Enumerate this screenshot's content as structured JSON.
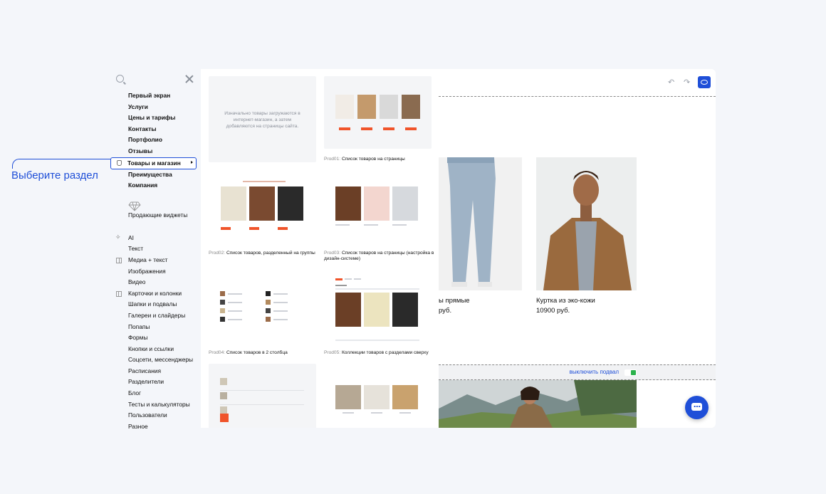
{
  "callout": {
    "label": "Выберите раздел"
  },
  "menu": {
    "sections": [
      {
        "label": "Первый экран",
        "bold": true
      },
      {
        "label": "Услуги",
        "bold": true
      },
      {
        "label": "Цены и тарифы",
        "bold": true
      },
      {
        "label": "Контакты",
        "bold": true
      },
      {
        "label": "Портфолио",
        "bold": true
      },
      {
        "label": "Отзывы",
        "bold": true
      },
      {
        "label": "Товары и магазин",
        "bold": true,
        "active": true
      },
      {
        "label": "Преимущества",
        "bold": true
      },
      {
        "label": "Компания",
        "bold": true
      }
    ],
    "promo": {
      "label": "Продающие виджеты",
      "icon": "diamond-icon"
    },
    "blocks": [
      {
        "label": "AI",
        "icon": "ai-icon"
      },
      {
        "label": "Текст"
      },
      {
        "label": "Медиа + текст",
        "icon": "media-icon"
      },
      {
        "label": "Изображения"
      },
      {
        "label": "Видео"
      },
      {
        "label": "Карточки и колонки",
        "icon": "cards-icon"
      },
      {
        "label": "Шапки и подвалы"
      },
      {
        "label": "Галереи и слайдеры"
      },
      {
        "label": "Попапы"
      },
      {
        "label": "Формы"
      },
      {
        "label": "Кнопки и ссылки"
      },
      {
        "label": "Соцсети, мессенджеры"
      },
      {
        "label": "Расписания"
      },
      {
        "label": "Разделители"
      },
      {
        "label": "Блог"
      },
      {
        "label": "Тесты и калькуляторы"
      },
      {
        "label": "Пользователи"
      },
      {
        "label": "Разное"
      }
    ]
  },
  "templates": {
    "intro": "Изначально товары загружаются в интернет-магазин, а затем добавляются на страницы сайта.",
    "cards": [
      {
        "code": "Prod01:",
        "name": "Список товаров на страницы"
      },
      {
        "code": "Prod02:",
        "name": "Список товаров, разделенный на группы"
      },
      {
        "code": "Prod03:",
        "name": "Список товаров на страницы (настройка в дизайн-системе)"
      },
      {
        "code": "Prod04:",
        "name": "Список товаров в 2 столбца"
      },
      {
        "code": "Prod05:",
        "name": "Коллекции товаров с разделами сверху"
      }
    ]
  },
  "preview": {
    "products": [
      {
        "title": "ы прямые",
        "price": "руб."
      },
      {
        "title": "Куртка из эко-кожи",
        "price": "10900 руб."
      }
    ],
    "footer_toggle": "выключить подвал"
  },
  "colors": {
    "accent": "#1f4fd8",
    "sale": "#f0542a",
    "toggle_on": "#2bb24c"
  }
}
